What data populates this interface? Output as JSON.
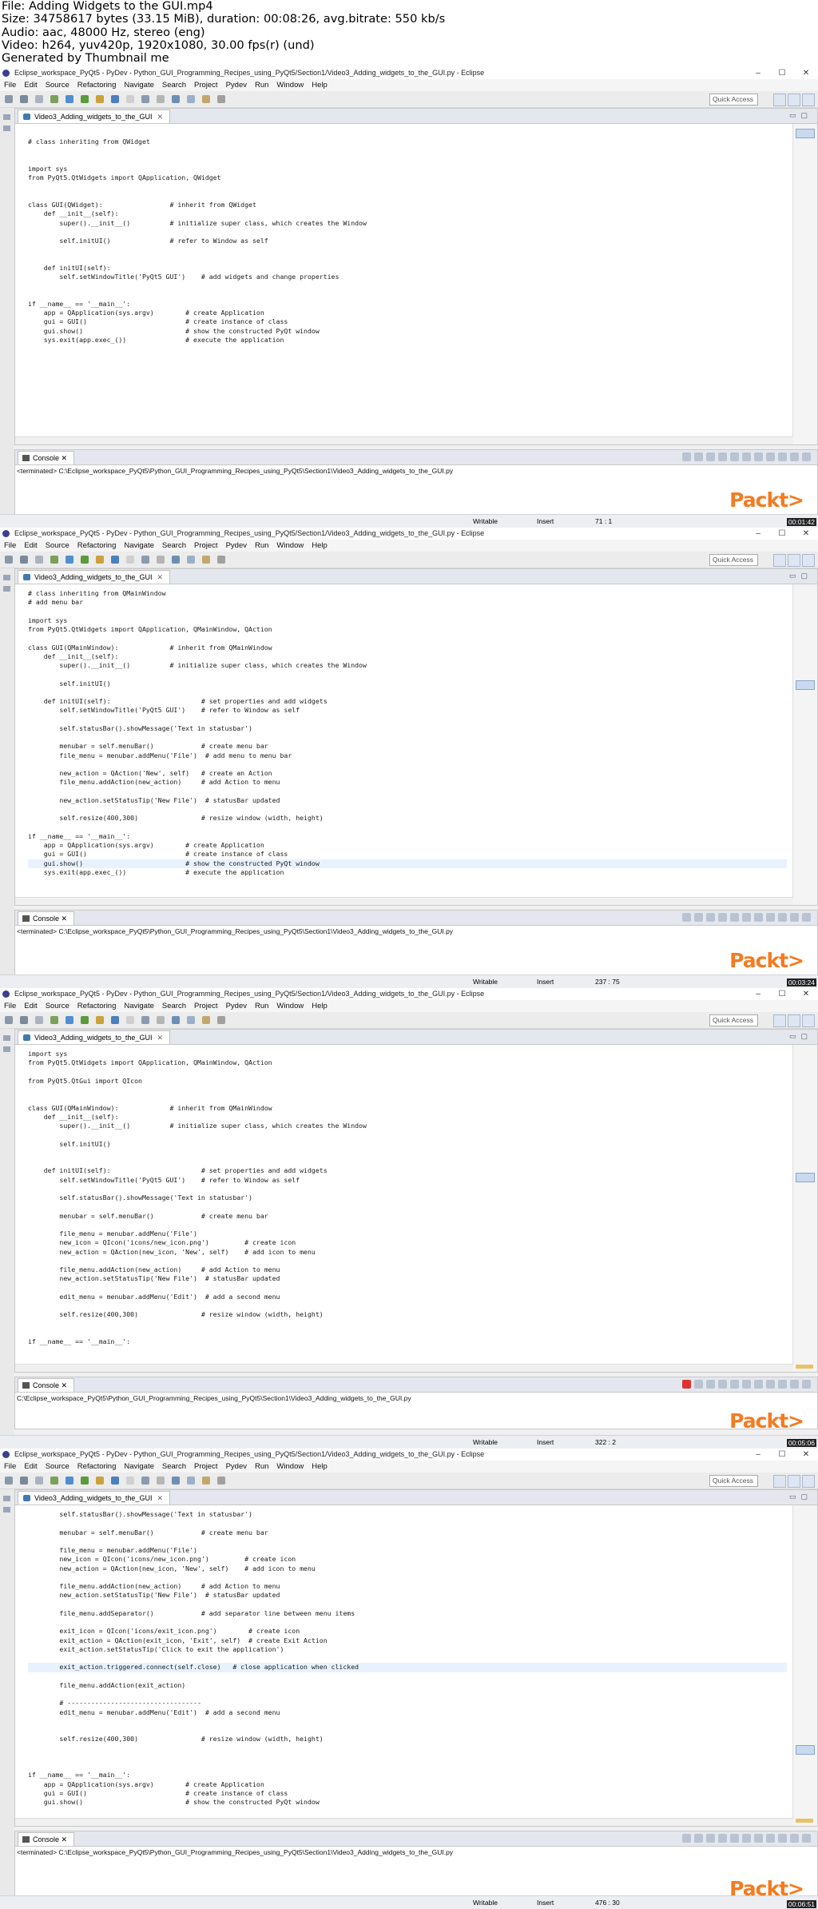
{
  "info": {
    "lines": [
      "File: Adding Widgets to the GUI.mp4",
      "Size: 34758617 bytes (33.15 MiB), duration: 00:08:26, avg.bitrate: 550 kb/s",
      "Audio: aac, 48000 Hz, stereo (eng)",
      "Video: h264, yuv420p, 1920x1080, 30.00 fps(r) (und)",
      "Generated by Thumbnail me"
    ]
  },
  "window_title": "Eclipse_workspace_PyQt5 - PyDev - Python_GUI_Programming_Recipes_using_PyQt5/Section1/Video3_Adding_widgets_to_the_GUI.py - Eclipse",
  "window_controls": {
    "minimize": "–",
    "maximize": "☐",
    "close": "✕"
  },
  "menus": [
    "File",
    "Edit",
    "Source",
    "Refactoring",
    "Navigate",
    "Search",
    "Project",
    "Pydev",
    "Run",
    "Window",
    "Help"
  ],
  "quick_access": "Quick Access",
  "editor_tab": "Video3_Adding_widgets_to_the_GUI",
  "console_tab": "Console",
  "status": {
    "writable": "Writable",
    "insert": "Insert"
  },
  "logo": "Packt>",
  "frames": [
    {
      "console_line": "<terminated> C:\\Eclipse_workspace_PyQt5\\Python_GUI_Programming_Recipes_using_PyQt5\\Section1\\Video3_Adding_widgets_to_the_GUI.py",
      "position": "71 : 1",
      "timestamp": "00:01:42",
      "code": [
        "",
        "# class inheriting from QWidget",
        "",
        "",
        "import sys",
        "from PyQt5.QtWidgets import QApplication, QWidget",
        "",
        "",
        "class GUI(QWidget):                 # inherit from QWidget",
        "    def __init__(self):",
        "        super().__init__()          # initialize super class, which creates the Window",
        "",
        "        self.initUI()               # refer to Window as self",
        "",
        "",
        "    def initUI(self):",
        "        self.setWindowTitle('PyQt5 GUI')    # add widgets and change properties",
        "",
        "",
        "if __name__ == '__main__':",
        "    app = QApplication(sys.argv)        # create Application",
        "    gui = GUI()                         # create instance of class",
        "    gui.show()                          # show the constructed PyQt window",
        "    sys.exit(app.exec_())               # execute the application"
      ]
    },
    {
      "console_line": "<terminated> C:\\Eclipse_workspace_PyQt5\\Python_GUI_Programming_Recipes_using_PyQt5\\Section1\\Video3_Adding_widgets_to_the_GUI.py",
      "position": "237 : 75",
      "timestamp": "00:03:24",
      "code": [
        "# class inheriting from QMainWindow",
        "# add menu bar",
        "",
        "import sys",
        "from PyQt5.QtWidgets import QApplication, QMainWindow, QAction",
        "",
        "class GUI(QMainWindow):             # inherit from QMainWindow",
        "    def __init__(self):",
        "        super().__init__()          # initialize super class, which creates the Window",
        "",
        "        self.initUI()",
        "",
        "    def initUI(self):                       # set properties and add widgets",
        "        self.setWindowTitle('PyQt5 GUI')    # refer to Window as self",
        "",
        "        self.statusBar().showMessage('Text in statusbar')",
        "",
        "        menubar = self.menuBar()            # create menu bar",
        "        file_menu = menubar.addMenu('File')  # add menu to menu bar",
        "",
        "        new_action = QAction('New', self)   # create an Action",
        "        file_menu.addAction(new_action)     # add Action to menu",
        "",
        "        new_action.setStatusTip('New File')  # statusBar updated",
        "",
        "        self.resize(400,300)                # resize window (width, height)",
        "",
        "if __name__ == '__main__':",
        "    app = QApplication(sys.argv)        # create Application",
        "    gui = GUI()                         # create instance of class",
        "    gui.show()                          # show the constructed PyQt window",
        "    sys.exit(app.exec_())               # execute the application"
      ]
    },
    {
      "console_line": "C:\\Eclipse_workspace_PyQt5\\Python_GUI_Programming_Recipes_using_PyQt5\\Section1\\Video3_Adding_widgets_to_the_GUI.py",
      "position": "322 : 2",
      "timestamp": "00:05:06",
      "code": [
        "import sys",
        "from PyQt5.QtWidgets import QApplication, QMainWindow, QAction",
        "",
        "from PyQt5.QtGui import QIcon",
        "",
        "",
        "class GUI(QMainWindow):             # inherit from QMainWindow",
        "    def __init__(self):",
        "        super().__init__()          # initialize super class, which creates the Window",
        "",
        "        self.initUI()",
        "",
        "",
        "    def initUI(self):                       # set properties and add widgets",
        "        self.setWindowTitle('PyQt5 GUI')    # refer to Window as self",
        "",
        "        self.statusBar().showMessage('Text in statusbar')",
        "",
        "        menubar = self.menuBar()            # create menu bar",
        "",
        "        file_menu = menubar.addMenu('File')",
        "        new_icon = QIcon('icons/new_icon.png')         # create icon",
        "        new_action = QAction(new_icon, 'New', self)    # add icon to menu",
        "",
        "        file_menu.addAction(new_action)     # add Action to menu",
        "        new_action.setStatusTip('New File')  # statusBar updated",
        "",
        "        edit_menu = menubar.addMenu('Edit')  # add a second menu",
        "",
        "        self.resize(400,300)                # resize window (width, height)",
        "",
        "",
        "if __name__ == '__main__':"
      ]
    },
    {
      "console_line": "<terminated> C:\\Eclipse_workspace_PyQt5\\Python_GUI_Programming_Recipes_using_PyQt5\\Section1\\Video3_Adding_widgets_to_the_GUI.py",
      "position": "476 : 30",
      "timestamp": "00:06:51",
      "code": [
        "        self.statusBar().showMessage('Text in statusbar')",
        "",
        "        menubar = self.menuBar()            # create menu bar",
        "",
        "        file_menu = menubar.addMenu('File')",
        "        new_icon = QIcon('icons/new_icon.png')         # create icon",
        "        new_action = QAction(new_icon, 'New', self)    # add icon to menu",
        "",
        "        file_menu.addAction(new_action)     # add Action to menu",
        "        new_action.setStatusTip('New File')  # statusBar updated",
        "",
        "        file_menu.addSeparator()            # add separator line between menu items",
        "",
        "        exit_icon = QIcon('icons/exit_icon.png')        # create icon",
        "        exit_action = QAction(exit_icon, 'Exit', self)  # create Exit Action",
        "        exit_action.setStatusTip('Click to exit the application')",
        "",
        "        exit_action.triggered.connect(self.close)   # close application when clicked",
        "",
        "        file_menu.addAction(exit_action)",
        "",
        "        # ----------------------------------",
        "        edit_menu = menubar.addMenu('Edit')  # add a second menu",
        "",
        "",
        "        self.resize(400,300)                # resize window (width, height)",
        "",
        "",
        "",
        "if __name__ == '__main__':",
        "    app = QApplication(sys.argv)        # create Application",
        "    gui = GUI()                         # create instance of class",
        "    gui.show()                          # show the constructed PyQt window"
      ]
    }
  ]
}
